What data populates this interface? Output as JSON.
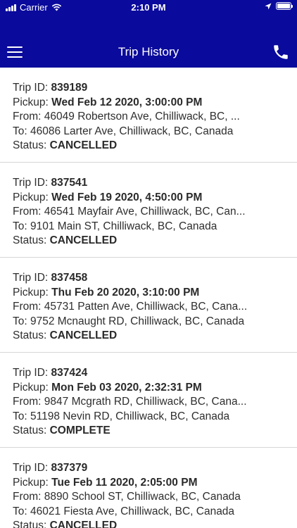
{
  "status_bar": {
    "carrier": "Carrier",
    "time": "2:10 PM"
  },
  "nav": {
    "title": "Trip History"
  },
  "labels": {
    "trip_id": "Trip ID: ",
    "pickup": "Pickup: ",
    "from": "From: ",
    "to": "To: ",
    "status": "Status: "
  },
  "trips": [
    {
      "id": "839189",
      "pickup": "Wed Feb 12 2020, 3:00:00 PM",
      "from": "46049 Robertson Ave, Chilliwack, BC, ...",
      "to": "46086 Larter Ave, Chilliwack, BC, Canada",
      "status": "CANCELLED"
    },
    {
      "id": "837541",
      "pickup": "Wed Feb 19 2020, 4:50:00 PM",
      "from": "46541 Mayfair Ave, Chilliwack, BC, Can...",
      "to": "9101 Main ST, Chilliwack, BC, Canada",
      "status": "CANCELLED"
    },
    {
      "id": "837458",
      "pickup": "Thu Feb 20 2020, 3:10:00 PM",
      "from": "45731 Patten Ave, Chilliwack, BC, Cana...",
      "to": "9752 Mcnaught RD, Chilliwack, BC, Canada",
      "status": "CANCELLED"
    },
    {
      "id": "837424",
      "pickup": "Mon Feb 03 2020, 2:32:31 PM",
      "from": "9847 Mcgrath RD, Chilliwack, BC, Cana...",
      "to": "51198 Nevin RD, Chilliwack, BC, Canada",
      "status": "COMPLETE"
    },
    {
      "id": "837379",
      "pickup": "Tue Feb 11 2020, 2:05:00 PM",
      "from": "8890 School ST, Chilliwack, BC, Canada",
      "to": "46021 Fiesta Ave, Chilliwack, BC, Canada",
      "status": "CANCELLED"
    }
  ],
  "colors": {
    "header_background": "#0a0a9c",
    "text": "#2e2e2e",
    "divider": "#d6d6d6"
  },
  "icons": {
    "menu": "hamburger-menu-icon",
    "call": "phone-icon",
    "wifi": "wifi-icon",
    "location": "location-arrow-icon",
    "battery": "battery-icon"
  }
}
